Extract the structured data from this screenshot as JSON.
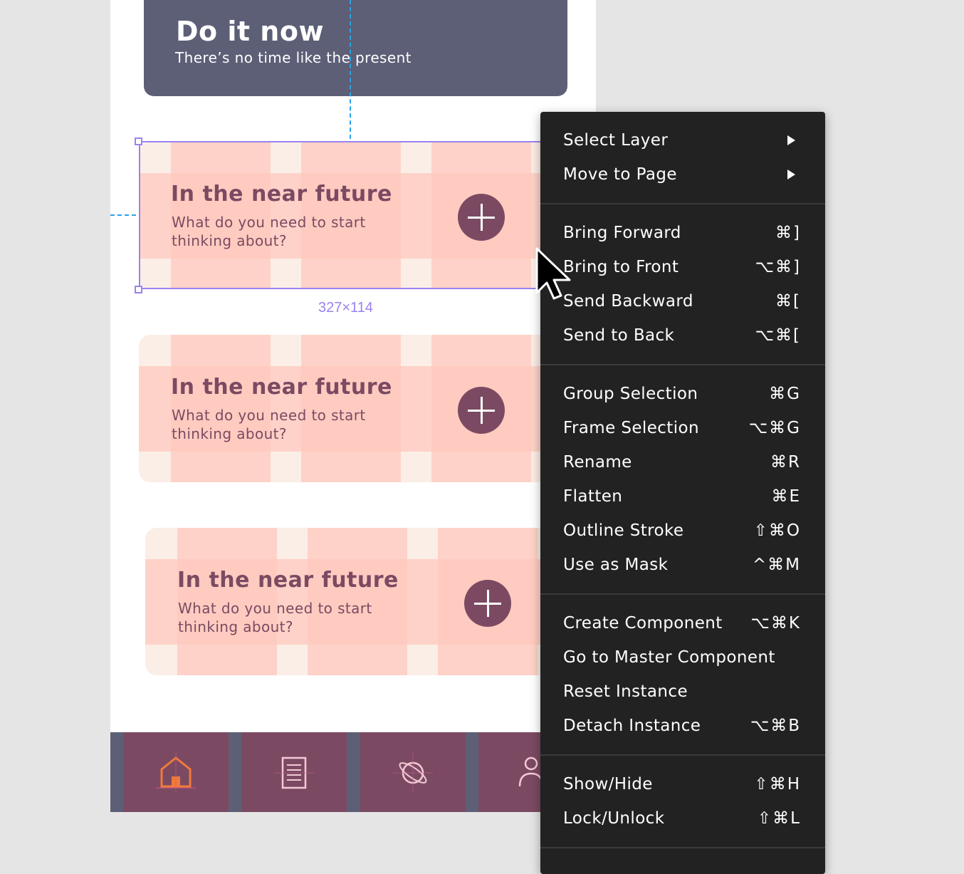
{
  "header": {
    "title": "Do it now",
    "subtitle": "There’s no time like the present"
  },
  "cards": [
    {
      "title": "In the near future",
      "description": "What do you need to start thinking about?",
      "button_icon": "plus-icon"
    },
    {
      "title": "In the near future",
      "description": "What do you need to start thinking about?",
      "button_icon": "plus-icon"
    },
    {
      "title": "In the near future",
      "description": "What do you need to start thinking about?",
      "button_icon": "plus-icon"
    }
  ],
  "selection": {
    "size_label": "327×114"
  },
  "tabbar": {
    "tabs": [
      {
        "icon": "home-icon"
      },
      {
        "icon": "list-icon"
      },
      {
        "icon": "planet-icon"
      },
      {
        "icon": "profile-icon"
      }
    ]
  },
  "context_menu": {
    "groups": [
      {
        "items": [
          {
            "label": "Select Layer",
            "submenu": true
          },
          {
            "label": "Move to Page",
            "submenu": true
          }
        ]
      },
      {
        "items": [
          {
            "label": "Bring Forward",
            "shortcut": "⌘]"
          },
          {
            "label": "Bring to Front",
            "shortcut": "⌥⌘]"
          },
          {
            "label": "Send Backward",
            "shortcut": "⌘["
          },
          {
            "label": "Send to Back",
            "shortcut": "⌥⌘["
          }
        ]
      },
      {
        "items": [
          {
            "label": "Group Selection",
            "shortcut": "⌘G"
          },
          {
            "label": "Frame Selection",
            "shortcut": "⌥⌘G"
          },
          {
            "label": "Rename",
            "shortcut": "⌘R"
          },
          {
            "label": "Flatten",
            "shortcut": "⌘E"
          },
          {
            "label": "Outline Stroke",
            "shortcut": "⇧⌘O"
          },
          {
            "label": "Use as Mask",
            "shortcut": "^⌘M"
          }
        ]
      },
      {
        "items": [
          {
            "label": "Create Component",
            "shortcut": "⌥⌘K"
          },
          {
            "label": "Go to Master Component",
            "shortcut": ""
          },
          {
            "label": "Reset Instance",
            "shortcut": ""
          },
          {
            "label": "Detach Instance",
            "shortcut": "⌥⌘B"
          }
        ]
      },
      {
        "items": [
          {
            "label": "Show/Hide",
            "shortcut": "⇧⌘H"
          },
          {
            "label": "Lock/Unlock",
            "shortcut": "⇧⌘L"
          }
        ]
      }
    ]
  },
  "colors": {
    "header_bg": "#5c5f76",
    "card_text": "#7b4a62",
    "selection": "#9b82ee",
    "guide": "#2aa3e8",
    "menu_bg": "#222222",
    "tab_accent": "#f07a3a"
  }
}
